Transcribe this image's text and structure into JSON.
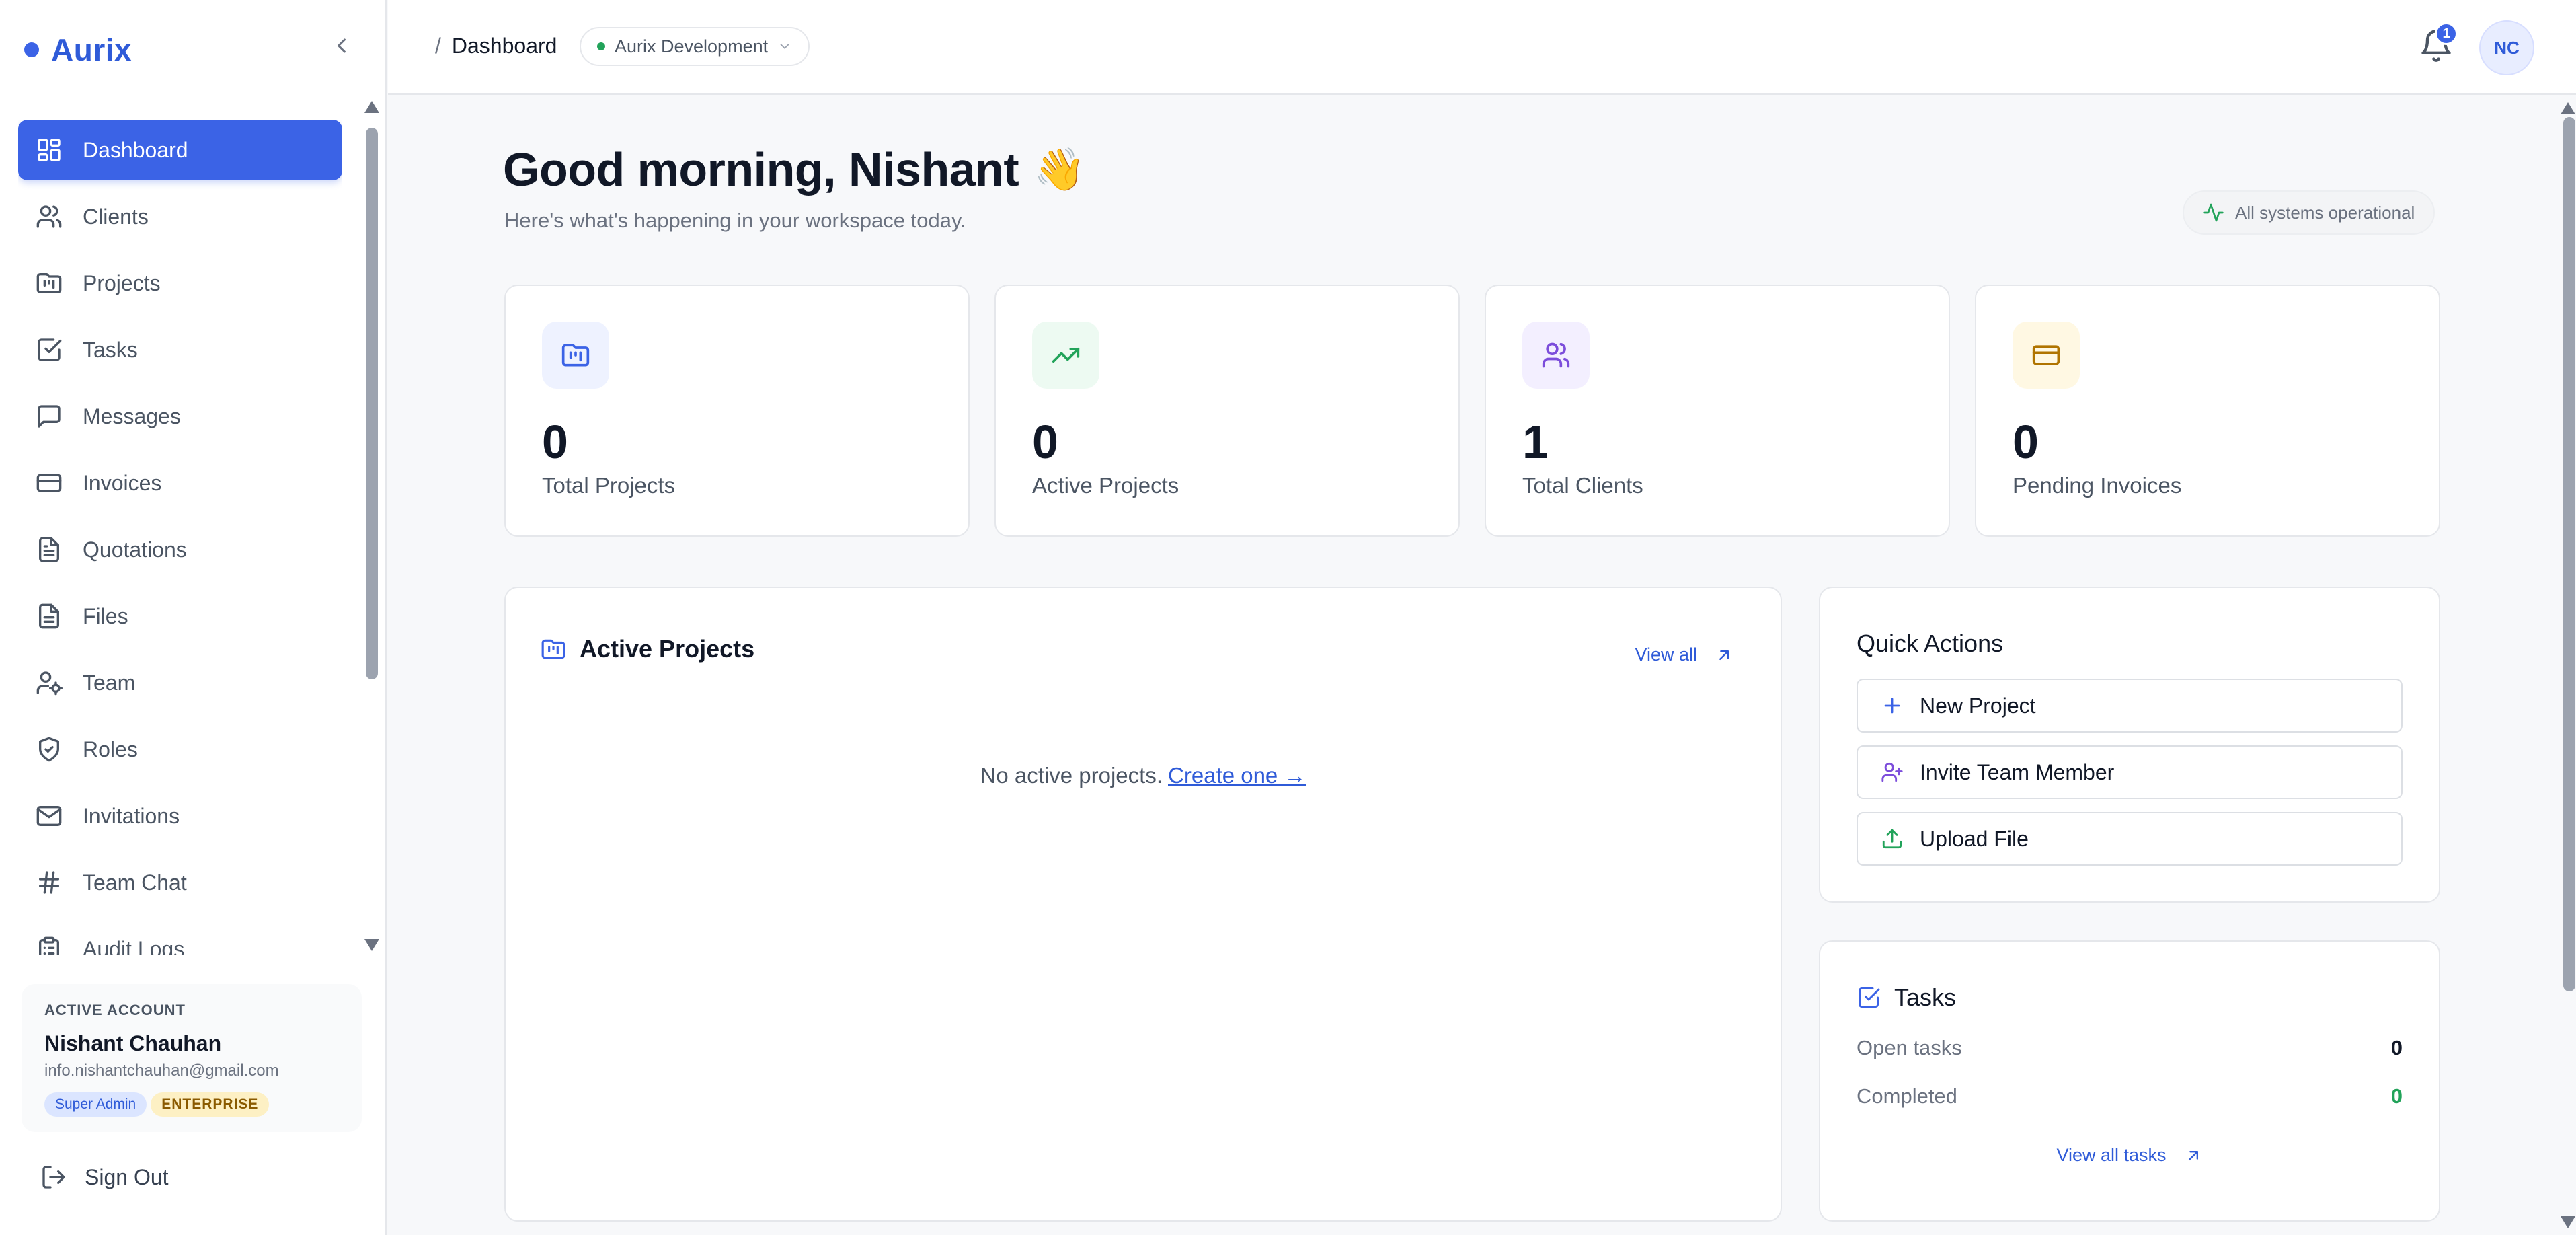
{
  "brand": {
    "name": "Aurix"
  },
  "sidebar": {
    "items": [
      {
        "label": "Dashboard",
        "icon": "layout-grid-icon",
        "active": true
      },
      {
        "label": "Clients",
        "icon": "users-icon"
      },
      {
        "label": "Projects",
        "icon": "folder-kanban-icon"
      },
      {
        "label": "Tasks",
        "icon": "check-square-icon"
      },
      {
        "label": "Messages",
        "icon": "message-square-icon"
      },
      {
        "label": "Invoices",
        "icon": "credit-card-icon"
      },
      {
        "label": "Quotations",
        "icon": "file-text-icon"
      },
      {
        "label": "Files",
        "icon": "file-icon"
      },
      {
        "label": "Team",
        "icon": "user-cog-icon"
      },
      {
        "label": "Roles",
        "icon": "shield-check-icon"
      },
      {
        "label": "Invitations",
        "icon": "mail-icon"
      },
      {
        "label": "Team Chat",
        "icon": "hash-icon"
      },
      {
        "label": "Audit Logs",
        "icon": "clipboard-list-icon"
      }
    ],
    "account": {
      "label": "ACTIVE ACCOUNT",
      "name": "Nishant Chauhan",
      "email": "info.nishantchauhan@gmail.com",
      "role_badge": "Super Admin",
      "plan_badge": "ENTERPRISE"
    },
    "signout_label": "Sign Out"
  },
  "topbar": {
    "breadcrumb_sep": "/",
    "breadcrumb": "Dashboard",
    "workspace": "Aurix Development",
    "notification_count": "1",
    "avatar_initials": "NC"
  },
  "greeting": {
    "title": "Good morning, Nishant",
    "emoji": "👋",
    "subtitle": "Here's what's happening in your workspace today."
  },
  "status": {
    "label": "All systems operational"
  },
  "stats": [
    {
      "value": "0",
      "label": "Total Projects",
      "icon": "folder-kanban-icon",
      "color": "#3b63e6",
      "bg": "#eef2ff"
    },
    {
      "value": "0",
      "label": "Active Projects",
      "icon": "trending-up-icon",
      "color": "#22a35a",
      "bg": "#edfaf2"
    },
    {
      "value": "1",
      "label": "Total Clients",
      "icon": "users-icon",
      "color": "#7c4ddb",
      "bg": "#f3efff"
    },
    {
      "value": "0",
      "label": "Pending Invoices",
      "icon": "credit-card-icon",
      "color": "#b07400",
      "bg": "#fff8e3"
    }
  ],
  "active_projects": {
    "title": "Active Projects",
    "view_all": "View all",
    "empty_text": "No active projects.",
    "create_link": "Create one →"
  },
  "quick_actions": {
    "title": "Quick Actions",
    "items": [
      {
        "label": "New Project",
        "icon": "plus-icon",
        "color": "#3b63e6"
      },
      {
        "label": "Invite Team Member",
        "icon": "user-plus-icon",
        "color": "#7c4ddb"
      },
      {
        "label": "Upload File",
        "icon": "upload-icon",
        "color": "#22a35a"
      }
    ]
  },
  "tasks": {
    "title": "Tasks",
    "open_label": "Open tasks",
    "open_value": "0",
    "completed_label": "Completed",
    "completed_value": "0",
    "view_all": "View all tasks"
  }
}
